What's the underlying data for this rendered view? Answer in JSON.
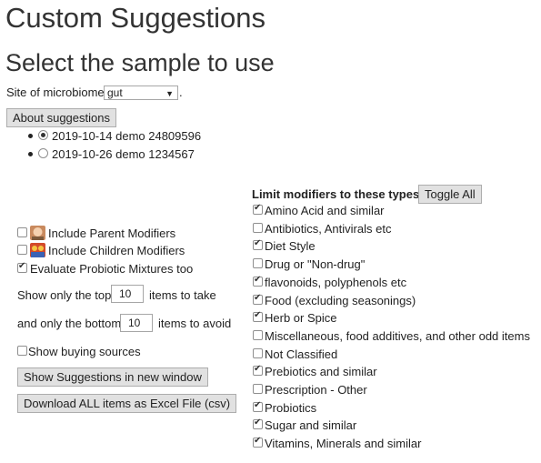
{
  "title": "Custom Suggestions",
  "subtitle": "Select the sample to use",
  "site": {
    "label": "Site of microbiome",
    "value": "gut",
    "suffix": "."
  },
  "about_button": "About suggestions",
  "samples": [
    {
      "label": "2019-10-14 demo 24809596",
      "selected": true
    },
    {
      "label": "2019-10-26 demo 1234567",
      "selected": false
    }
  ],
  "options": {
    "parent": {
      "label": "Include Parent Modifiers",
      "checked": false
    },
    "children": {
      "label": "Include Children Modifiers",
      "checked": false
    },
    "probiotic": {
      "label": "Evaluate Probiotic Mixtures too",
      "checked": true
    },
    "top_prefix": "Show only the top",
    "top_value": "10",
    "top_suffix": "items to take",
    "bottom_prefix": "and only the bottom",
    "bottom_value": "10",
    "bottom_suffix": "items to avoid",
    "buying": {
      "label": "Show buying sources",
      "checked": false
    }
  },
  "show_button": "Show Suggestions in new window",
  "download_button": "Download ALL items as Excel File (csv)",
  "modifiers": {
    "heading": "Limit modifiers to these types:",
    "toggle_button": "Toggle All",
    "items": [
      {
        "label": "Amino Acid and similar",
        "checked": true
      },
      {
        "label": "Antibiotics, Antivirals etc",
        "checked": false
      },
      {
        "label": "Diet Style",
        "checked": true
      },
      {
        "label": "Drug or \"Non-drug\"",
        "checked": false
      },
      {
        "label": "flavonoids, polyphenols etc",
        "checked": true
      },
      {
        "label": "Food (excluding seasonings)",
        "checked": true
      },
      {
        "label": "Herb or Spice",
        "checked": true
      },
      {
        "label": "Miscellaneous, food additives, and other odd items",
        "checked": false
      },
      {
        "label": "Not Classified",
        "checked": false
      },
      {
        "label": "Prebiotics and similar",
        "checked": true
      },
      {
        "label": "Prescription - Other",
        "checked": false
      },
      {
        "label": "Probiotics",
        "checked": true
      },
      {
        "label": "Sugar and similar",
        "checked": true
      },
      {
        "label": "Vitamins, Minerals and similar",
        "checked": true
      }
    ]
  }
}
